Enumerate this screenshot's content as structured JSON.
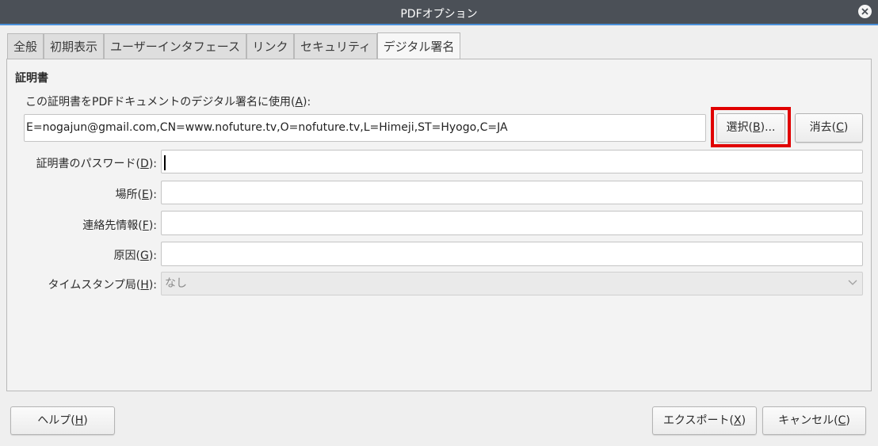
{
  "window": {
    "title": "PDFオプション",
    "close_label": "×"
  },
  "tabs": [
    {
      "label": "全般",
      "active": false
    },
    {
      "label": "初期表示",
      "active": false
    },
    {
      "label": "ユーザーインタフェース",
      "active": false
    },
    {
      "label": "リンク",
      "active": false
    },
    {
      "label": "セキュリティ",
      "active": false
    },
    {
      "label": "デジタル署名",
      "active": true
    }
  ],
  "certificate": {
    "section_title": "証明書",
    "use_label_prefix": "この証明書をPDFドキュメントのデジタル署名に使用(",
    "use_label_key": "A",
    "use_label_suffix": "):",
    "value": "E=nogajun@gmail.com,CN=www.nofuture.tv,O=nofuture.tv,L=Himeji,ST=Hyogo,C=JA",
    "select_button": {
      "prefix": "選択(",
      "key": "B",
      "suffix": ")..."
    },
    "clear_button": {
      "prefix": "消去(",
      "key": "C",
      "suffix": ")"
    }
  },
  "fields": [
    {
      "prefix": "証明書のパスワード(",
      "key": "D",
      "suffix": "):",
      "value": ""
    },
    {
      "prefix": "場所(",
      "key": "E",
      "suffix": "):",
      "value": ""
    },
    {
      "prefix": "連絡先情報(",
      "key": "F",
      "suffix": "):",
      "value": ""
    },
    {
      "prefix": "原因(",
      "key": "G",
      "suffix": "):",
      "value": ""
    }
  ],
  "timestamp": {
    "prefix": "タイムスタンプ局(",
    "key": "H",
    "suffix": "):",
    "selected": "なし"
  },
  "footer": {
    "help": {
      "prefix": "ヘルプ(",
      "key": "H",
      "suffix": ")"
    },
    "export": {
      "prefix": "エクスポート(",
      "key": "X",
      "suffix": ")"
    },
    "cancel": {
      "prefix": "キャンセル(",
      "key": "C",
      "suffix": ")"
    }
  },
  "colors": {
    "titlebar": "#4b5057",
    "highlight": "#e00000"
  }
}
